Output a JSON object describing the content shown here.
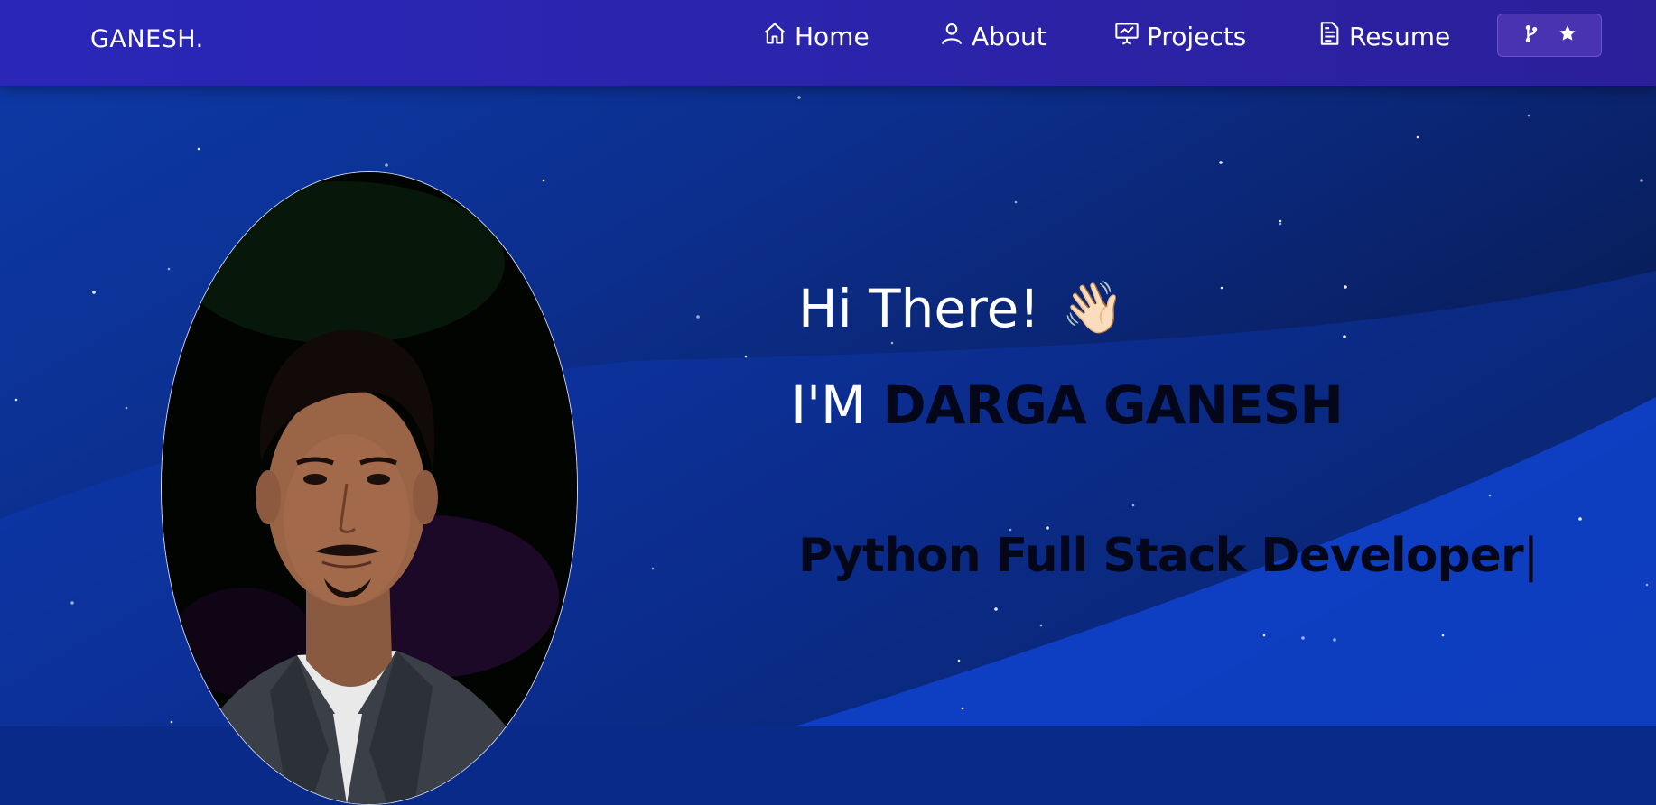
{
  "brand": {
    "logo": "GANESH."
  },
  "nav": {
    "items": [
      {
        "label": "Home",
        "icon": "home-icon"
      },
      {
        "label": "About",
        "icon": "user-icon"
      },
      {
        "label": "Projects",
        "icon": "presentation-icon"
      },
      {
        "label": "Resume",
        "icon": "document-icon"
      }
    ],
    "github_button": {
      "icons": [
        "fork-icon",
        "star-icon"
      ]
    }
  },
  "hero": {
    "greeting": "Hi There!",
    "wave_emoji": "👋🏻",
    "intro_prefix": "I'M",
    "name": "DARGA GANESH",
    "role": "Python Full Stack Developer",
    "cursor": "|"
  },
  "colors": {
    "navbar": "#2a26b8",
    "background": "#0c2f8f",
    "name_text": "#04061a",
    "white_text": "#ffffff"
  }
}
